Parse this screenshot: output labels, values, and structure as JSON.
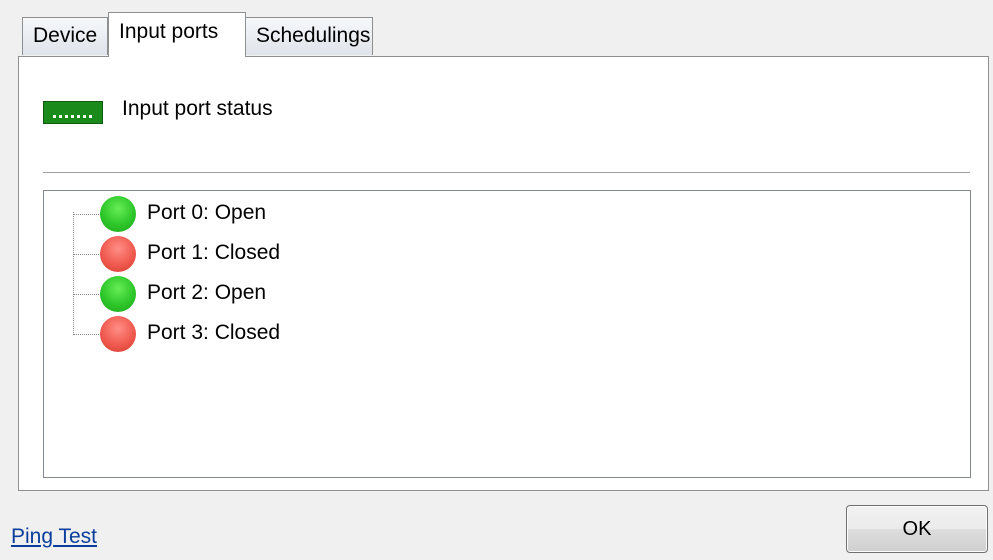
{
  "tabs": [
    {
      "label": "Device",
      "active": false
    },
    {
      "label": "Input ports",
      "active": true
    },
    {
      "label": "Schedulings",
      "active": false
    }
  ],
  "status": {
    "icon": "port-status-icon",
    "label": "Input port status"
  },
  "ports": [
    {
      "label": "Port 0: Open",
      "state": "open",
      "icon": "green-circle-icon"
    },
    {
      "label": "Port 1: Closed",
      "state": "closed",
      "icon": "red-circle-icon"
    },
    {
      "label": "Port 2: Open",
      "state": "open",
      "icon": "green-circle-icon"
    },
    {
      "label": "Port 3: Closed",
      "state": "closed",
      "icon": "red-circle-icon"
    }
  ],
  "colors": {
    "open": "#2ec62a",
    "closed": "#f05a4f",
    "status_icon": "#1a8a1a",
    "link": "#0b3d9c"
  },
  "footer": {
    "ping_test_label": "Ping Test",
    "ok_label": "OK"
  }
}
